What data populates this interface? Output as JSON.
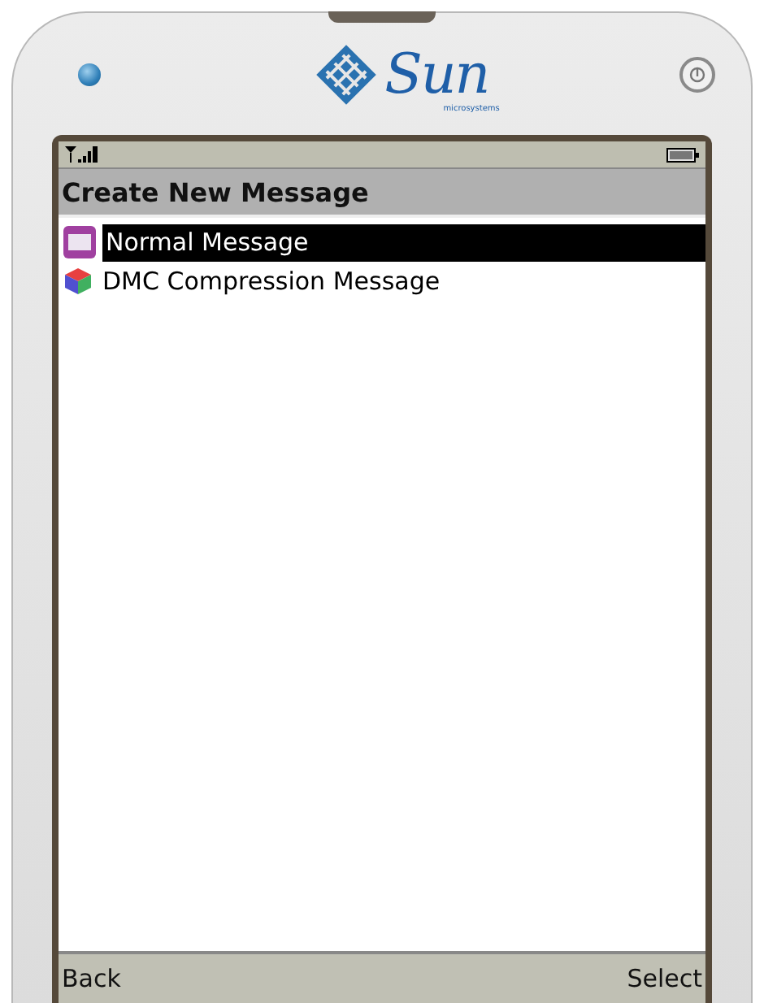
{
  "logo": {
    "name": "Sun",
    "tagline": "microsystems"
  },
  "screen": {
    "title": "Create New Message",
    "items": [
      {
        "label": "Normal Message",
        "kind": "envelope",
        "selected": true
      },
      {
        "label": "DMC Compression Message",
        "kind": "cube",
        "selected": false
      }
    ],
    "softkeys": {
      "left": "Back",
      "right": "Select"
    }
  }
}
